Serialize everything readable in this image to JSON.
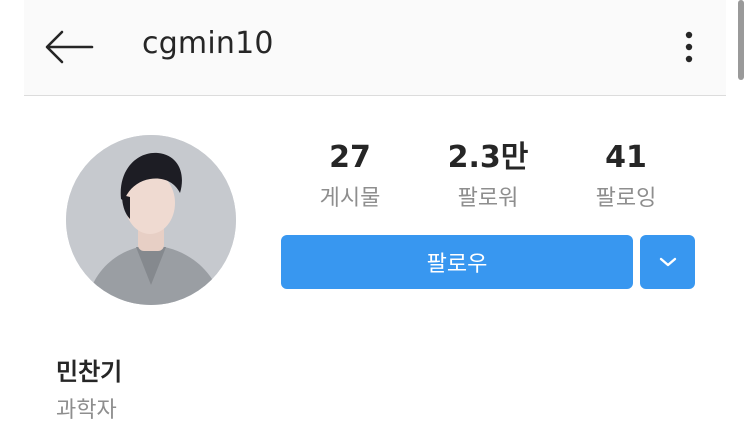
{
  "header": {
    "username": "cgmin10"
  },
  "icons": {
    "back": "back-arrow-icon",
    "more": "more-vertical-icon",
    "chevron": "chevron-down-icon"
  },
  "stats": [
    {
      "value": "27",
      "label": "게시물"
    },
    {
      "value": "2.3만",
      "label": "팔로워"
    },
    {
      "value": "41",
      "label": "팔로잉"
    }
  ],
  "actions": {
    "follow_label": "팔로우"
  },
  "profile": {
    "name": "민찬기",
    "category": "과학자"
  },
  "colors": {
    "accent": "#3897f0",
    "text": "#262626",
    "muted": "#8e8e8e"
  }
}
